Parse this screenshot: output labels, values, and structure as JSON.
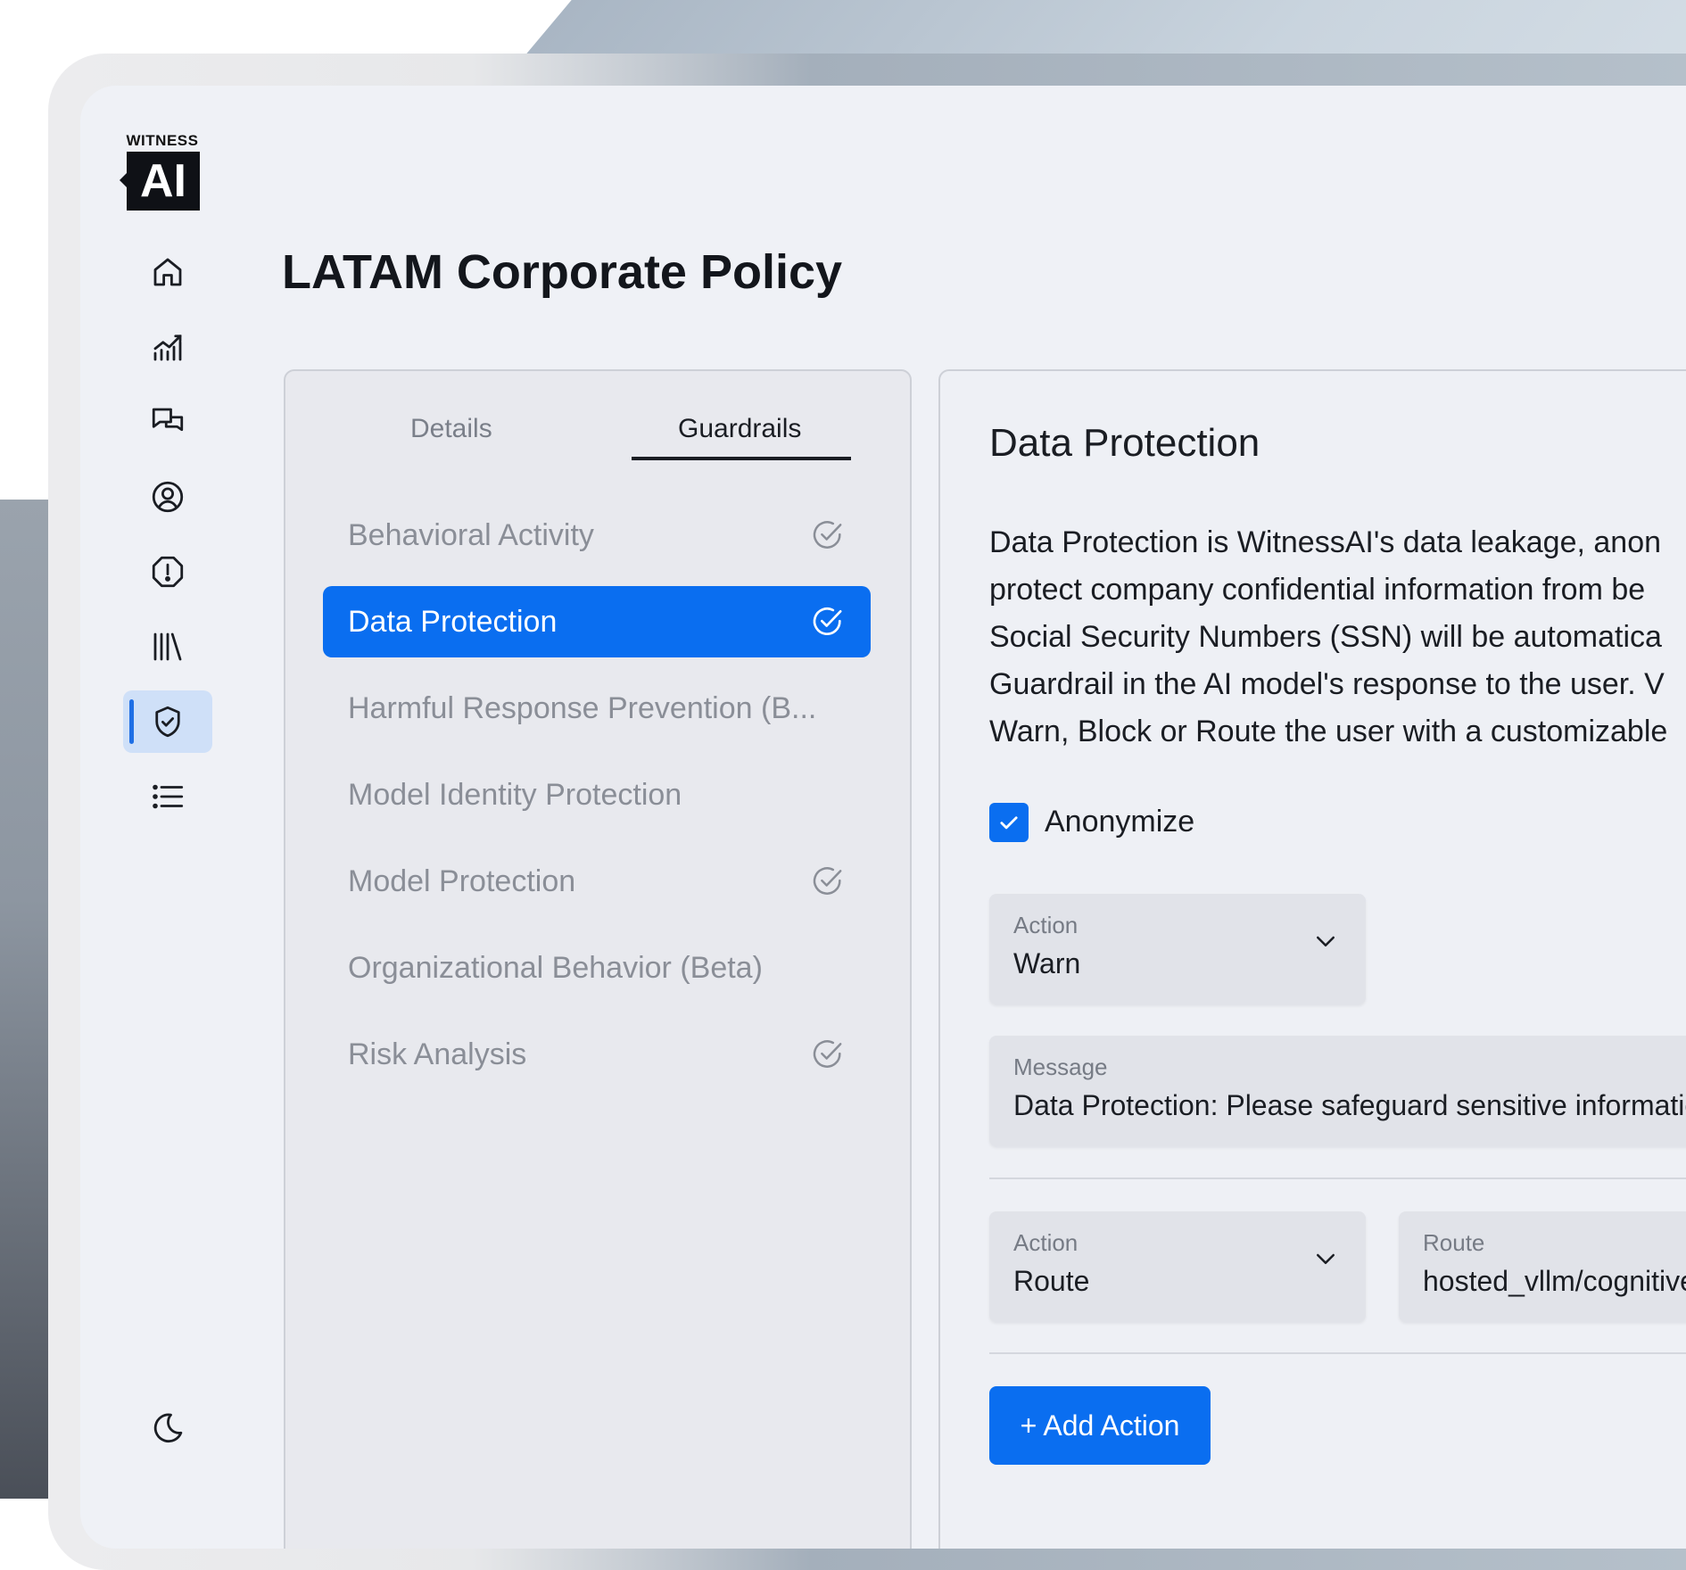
{
  "logo": {
    "top_text": "WITNESS",
    "box_text": "AI"
  },
  "sidebar": {
    "items": [
      {
        "icon": "home-icon"
      },
      {
        "icon": "analytics-icon"
      },
      {
        "icon": "chat-icon"
      },
      {
        "icon": "user-icon"
      },
      {
        "icon": "alert-icon"
      },
      {
        "icon": "library-icon"
      },
      {
        "icon": "shield-check-icon",
        "active": true
      },
      {
        "icon": "list-icon"
      }
    ],
    "bottom_icon": "moon-icon"
  },
  "page": {
    "title": "LATAM Corporate Policy"
  },
  "tabs": [
    {
      "label": "Details",
      "active": false
    },
    {
      "label": "Guardrails",
      "active": true
    }
  ],
  "guardrails": [
    {
      "label": "Behavioral Activity",
      "checked": true,
      "active": false
    },
    {
      "label": "Data Protection",
      "checked": true,
      "active": true
    },
    {
      "label": "Harmful Response Prevention (B...",
      "checked": false,
      "active": false
    },
    {
      "label": "Model Identity Protection",
      "checked": false,
      "active": false
    },
    {
      "label": "Model Protection",
      "checked": true,
      "active": false
    },
    {
      "label": "Organizational Behavior (Beta)",
      "checked": false,
      "active": false
    },
    {
      "label": "Risk Analysis",
      "checked": true,
      "active": false
    }
  ],
  "detail": {
    "title": "Data Protection",
    "description_lines": [
      "Data Protection is WitnessAI's data leakage, anon",
      "protect company confidential information from be",
      "Social Security Numbers (SSN) will be automatica",
      "Guardrail in the AI model's response to the user. V",
      "Warn, Block or Route the user with a customizable"
    ],
    "anonymize": {
      "label": "Anonymize",
      "checked": true
    },
    "action1": {
      "label": "Action",
      "value": "Warn"
    },
    "message": {
      "label": "Message",
      "value": "Data Protection: Please safeguard sensitive informatior"
    },
    "action2": {
      "label": "Action",
      "value": "Route"
    },
    "route": {
      "label": "Route",
      "value": "hosted_vllm/cognitive"
    },
    "add_action_label": "+ Add Action"
  },
  "colors": {
    "accent": "#0a6ef0",
    "background": "#eff1f6"
  }
}
